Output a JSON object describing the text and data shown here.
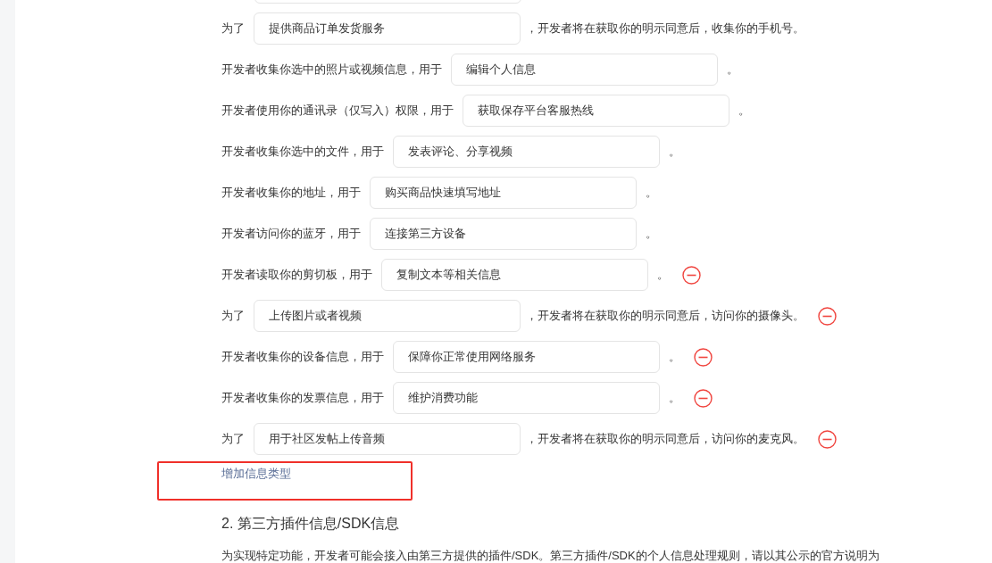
{
  "rows": [
    {
      "kind": "purpose",
      "prefix": "为了",
      "value": "提供商品订单发货服务",
      "suffix": "，开发者将在获取你的明示同意后，收集你的手机号。",
      "removable": false
    },
    {
      "kind": "use",
      "prefix": "开发者收集你选中的照片或视频信息，用于",
      "value": "编辑个人信息",
      "suffix": "。",
      "removable": false
    },
    {
      "kind": "use",
      "prefix": "开发者使用你的通讯录（仅写入）权限，用于",
      "value": "获取保存平台客服热线",
      "suffix": "。",
      "removable": false
    },
    {
      "kind": "use",
      "prefix": "开发者收集你选中的文件，用于",
      "value": "发表评论、分享视频",
      "suffix": "。",
      "removable": false
    },
    {
      "kind": "use",
      "prefix": "开发者收集你的地址，用于",
      "value": "购买商品快速填写地址",
      "suffix": "。",
      "removable": false
    },
    {
      "kind": "use",
      "prefix": "开发者访问你的蓝牙，用于",
      "value": "连接第三方设备",
      "suffix": "。",
      "removable": false
    },
    {
      "kind": "use",
      "prefix": "开发者读取你的剪切板，用于",
      "value": "复制文本等相关信息",
      "suffix": "。",
      "removable": true
    },
    {
      "kind": "purpose",
      "prefix": "为了",
      "value": "上传图片或者视频",
      "suffix": "，开发者将在获取你的明示同意后，访问你的摄像头。",
      "removable": true
    },
    {
      "kind": "use",
      "prefix": "开发者收集你的设备信息，用于",
      "value": "保障你正常使用网络服务",
      "suffix": "。",
      "removable": true
    },
    {
      "kind": "use",
      "prefix": "开发者收集你的发票信息，用于",
      "value": "维护消费功能",
      "suffix": "。",
      "removable": true
    },
    {
      "kind": "purpose",
      "prefix": "为了",
      "value": "用于社区发帖上传音频",
      "suffix": "，开发者将在获取你的明示同意后，访问你的麦克风。",
      "removable": true
    }
  ],
  "add_link": "增加信息类型",
  "section_heading": "2.  第三方插件信息/SDK信息",
  "section_text": "为实现特定功能，开发者可能会接入由第三方提供的插件/SDK。第三方插件/SDK的个人信息处理规则，请以其公示的官方说明为"
}
